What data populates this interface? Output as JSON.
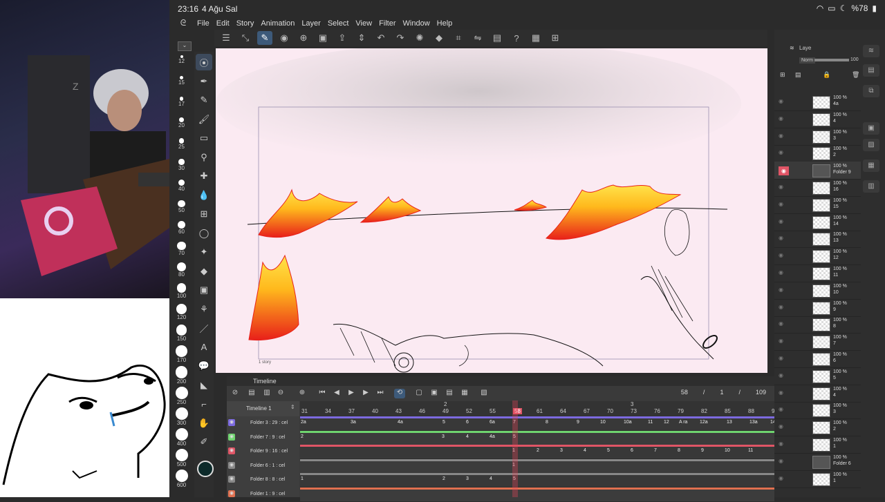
{
  "status": {
    "time": "23:16",
    "date": "4 Ağu Sal",
    "battery": "%78"
  },
  "menu": [
    "File",
    "Edit",
    "Story",
    "Animation",
    "Layer",
    "Select",
    "View",
    "Filter",
    "Window",
    "Help"
  ],
  "brush_sizes": [
    "12",
    "15",
    "17",
    "20",
    "25",
    "30",
    "40",
    "50",
    "60",
    "70",
    "80",
    "100",
    "120",
    "150",
    "170",
    "200",
    "250",
    "300",
    "400",
    "500",
    "600"
  ],
  "canvas": {
    "frame_label": "1 story"
  },
  "timeline": {
    "title": "Timeline",
    "name": "Timeline 1",
    "counter": [
      "58",
      "/",
      "1",
      "/",
      "109"
    ],
    "ruler": [
      "31",
      "34",
      "37",
      "40",
      "43",
      "46",
      "49",
      "52",
      "55",
      "58",
      "61",
      "64",
      "67",
      "70",
      "73",
      "76",
      "79",
      "82",
      "85",
      "88",
      "9"
    ],
    "ruler_top": [
      "2",
      "3"
    ],
    "tracks": [
      {
        "name": "Folder 3 : 29 : cel",
        "color": "#7c6ae0",
        "cels": [
          "2a",
          "3a",
          "4a",
          "5",
          "6",
          "6a",
          "7",
          "8",
          "9",
          "10",
          "10a",
          "11",
          "12",
          "A ra",
          "12a",
          "13",
          "13a",
          "14"
        ]
      },
      {
        "name": "Folder 7 : 9 : cel",
        "color": "#6fd46f",
        "cels": [
          "2",
          "3",
          "4",
          "4a",
          "5"
        ]
      },
      {
        "name": "Folder 9 : 16 : cel",
        "color": "#e05566",
        "cels": [
          "1",
          "2",
          "3",
          "4",
          "5",
          "6",
          "7",
          "8",
          "9",
          "10",
          "11"
        ]
      },
      {
        "name": "Folder 6 : 1 : cel",
        "color": "#888888",
        "cels": [
          "1"
        ]
      },
      {
        "name": "Folder 8 : 8 : cel",
        "color": "#888888",
        "cels": [
          "1",
          "2",
          "3",
          "4",
          "5"
        ]
      },
      {
        "name": "Folder 1 : 9 : cel",
        "color": "#e07050",
        "cels": []
      }
    ]
  },
  "layers": {
    "header": {
      "tab": "Laye",
      "blend": "Norm",
      "opacity": "100"
    },
    "items": [
      {
        "pct": "100 %",
        "name": "4a"
      },
      {
        "pct": "100 %",
        "name": "4"
      },
      {
        "pct": "100 %",
        "name": "3"
      },
      {
        "pct": "100 %",
        "name": "2"
      },
      {
        "pct": "100 %",
        "name": "Folder 9",
        "folder": true
      },
      {
        "pct": "100 %",
        "name": "16"
      },
      {
        "pct": "100 %",
        "name": "15"
      },
      {
        "pct": "100 %",
        "name": "14"
      },
      {
        "pct": "100 %",
        "name": "13"
      },
      {
        "pct": "100 %",
        "name": "12"
      },
      {
        "pct": "100 %",
        "name": "11"
      },
      {
        "pct": "100 %",
        "name": "10"
      },
      {
        "pct": "100 %",
        "name": "9"
      },
      {
        "pct": "100 %",
        "name": "8"
      },
      {
        "pct": "100 %",
        "name": "7"
      },
      {
        "pct": "100 %",
        "name": "6"
      },
      {
        "pct": "100 %",
        "name": "5"
      },
      {
        "pct": "100 %",
        "name": "4"
      },
      {
        "pct": "100 %",
        "name": "3"
      },
      {
        "pct": "100 %",
        "name": "2"
      },
      {
        "pct": "100 %",
        "name": "1"
      },
      {
        "pct": "100 %",
        "name": "Folder 6",
        "folder": true
      },
      {
        "pct": "100 %",
        "name": "1"
      }
    ]
  },
  "colors": {
    "accent": "#e05566",
    "panel": "#2e2e2e",
    "canvas": "#fbeaf2"
  }
}
